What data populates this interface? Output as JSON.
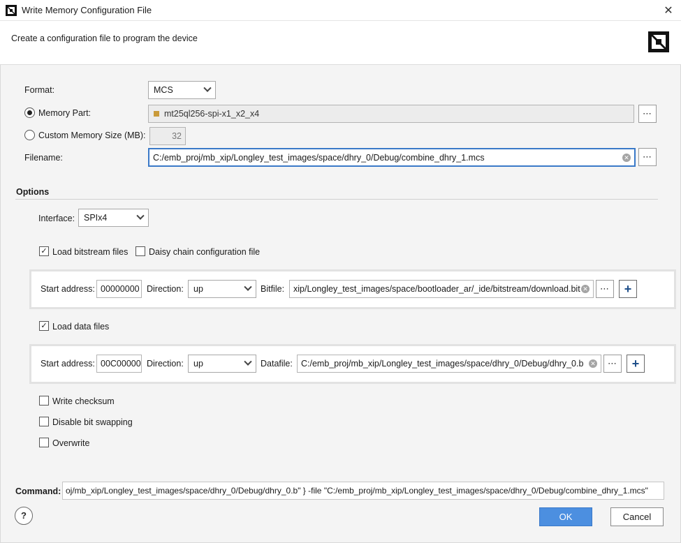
{
  "window": {
    "title": "Write Memory Configuration File",
    "close_glyph": "✕"
  },
  "header": {
    "description": "Create a configuration file to program the device"
  },
  "format": {
    "label": "Format:",
    "value": "MCS"
  },
  "memory_part": {
    "label": "Memory Part:",
    "selected": true,
    "value": "mt25ql256-spi-x1_x2_x4"
  },
  "custom_memory": {
    "label": "Custom Memory Size (MB):",
    "selected": false,
    "value": "32"
  },
  "filename": {
    "label": "Filename:",
    "value": "C:/emb_proj/mb_xip/Longley_test_images/space/dhry_0/Debug/combine_dhry_1.mcs"
  },
  "options": {
    "heading": "Options",
    "interface_label": "Interface:",
    "interface_value": "SPIx4",
    "load_bitstream": {
      "label": "Load bitstream files",
      "checked": true
    },
    "daisy_chain": {
      "label": "Daisy chain configuration file",
      "checked": false
    },
    "bitstream_row": {
      "start_label": "Start address:",
      "start_value": "00000000",
      "direction_label": "Direction:",
      "direction_value": "up",
      "file_label": "Bitfile:",
      "file_value": "xip/Longley_test_images/space/bootloader_ar/_ide/bitstream/download.bit"
    },
    "load_data": {
      "label": "Load data files",
      "checked": true
    },
    "data_row": {
      "start_label": "Start address:",
      "start_value": "00C00000",
      "direction_label": "Direction:",
      "direction_value": "up",
      "file_label": "Datafile:",
      "file_value": "C:/emb_proj/mb_xip/Longley_test_images/space/dhry_0/Debug/dhry_0.b"
    },
    "write_checksum": {
      "label": "Write checksum",
      "checked": false
    },
    "disable_bit_swapping": {
      "label": "Disable bit swapping",
      "checked": false
    },
    "overwrite": {
      "label": "Overwrite",
      "checked": false
    }
  },
  "command": {
    "label": "Command:",
    "value": "oj/mb_xip/Longley_test_images/space/dhry_0/Debug/dhry_0.b\" } -file \"C:/emb_proj/mb_xip/Longley_test_images/space/dhry_0/Debug/combine_dhry_1.mcs\""
  },
  "buttons": {
    "help": "?",
    "ok": "OK",
    "cancel": "Cancel",
    "browse": "⋯",
    "add": "+"
  },
  "colors": {
    "accent": "#4c8fe0",
    "focus_border": "#3a79c8",
    "panel_bg": "#f4f4f4"
  },
  "icons": {
    "app": "amd-logo-icon",
    "brand": "amd-logo-icon",
    "part": "chip-icon",
    "clear": "clear-circle-icon",
    "check": "checkmark-icon"
  }
}
